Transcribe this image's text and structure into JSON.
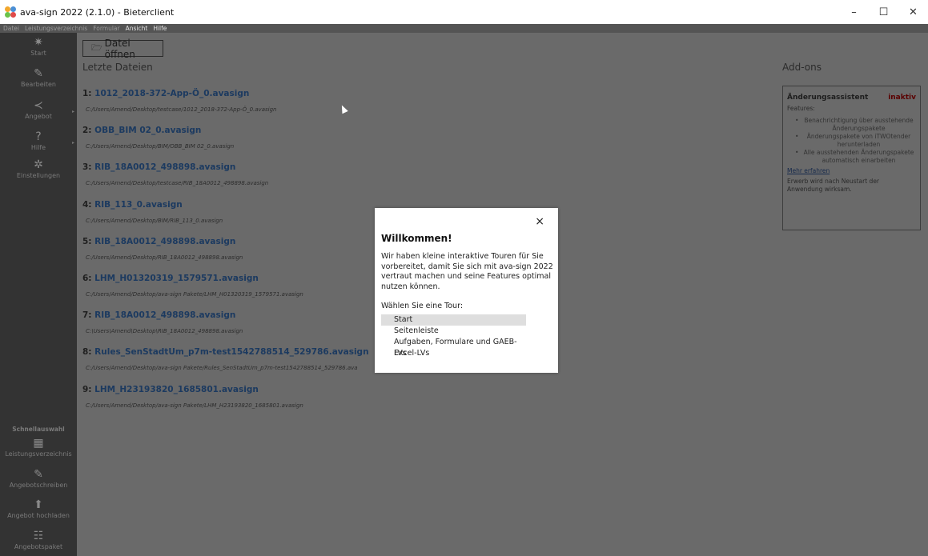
{
  "window": {
    "title": "ava-sign 2022 (2.1.0) - Bieterclient",
    "controls": {
      "minimize": "–",
      "maximize": "☐",
      "close": "✕"
    }
  },
  "menu": [
    "Datei",
    "Leistungsverzeichnis",
    "Formular",
    "Ansicht",
    "Hilfe"
  ],
  "sidebar": {
    "items": [
      {
        "icon": "✷",
        "label": "Start"
      },
      {
        "icon": "✎",
        "label": "Bearbeiten"
      },
      {
        "icon": "≺",
        "label": "Angebot"
      },
      {
        "icon": "?",
        "label": "Hilfe"
      },
      {
        "icon": "✲",
        "label": "Einstellungen"
      }
    ],
    "quick_title": "Schnellauswahl",
    "quick_items": [
      {
        "icon": "▦",
        "label": "Leistungsverzeichnis"
      },
      {
        "icon": "✎",
        "label": "Angebotschreiben"
      },
      {
        "icon": "⬆",
        "label": "Angebot hochladen"
      },
      {
        "icon": "☷",
        "label": "Angebotspaket"
      }
    ]
  },
  "main": {
    "open_button": {
      "icon": "🗁",
      "label": "Datei öffnen"
    },
    "recent_title": "Letzte Dateien",
    "recent_files": [
      {
        "index": "1:",
        "name": "1012_2018-372-App-Ö_0.avasign",
        "path": "C:/Users/Amend/Desktop/testcase/1012_2018-372-App-Ö_0.avasign"
      },
      {
        "index": "2:",
        "name": "OBB_BIM 02_0.avasign",
        "path": "C:/Users/Amend/Desktop/BIM/OBB_BIM 02_0.avasign"
      },
      {
        "index": "3:",
        "name": "RIB_18A0012_498898.avasign",
        "path": "C:/Users/Amend/Desktop/testcase/RIB_18A0012_498898.avasign"
      },
      {
        "index": "4:",
        "name": "RIB_113_0.avasign",
        "path": "C:/Users/Amend/Desktop/BIM/RIB_113_0.avasign"
      },
      {
        "index": "5:",
        "name": "RIB_18A0012_498898.avasign",
        "path": "C:/Users/Amend/Desktop/RIB_18A0012_498898.avasign"
      },
      {
        "index": "6:",
        "name": "LHM_H01320319_1579571.avasign",
        "path": "C:/Users/Amend/Desktop/ava-sign Pakete/LHM_H01320319_1579571.avasign"
      },
      {
        "index": "7:",
        "name": "RIB_18A0012_498898.avasign",
        "path": "C:\\Users\\Amend\\Desktop\\RIB_18A0012_498898.avasign"
      },
      {
        "index": "8:",
        "name": "Rules_SenStadtUm_p7m-test1542788514_529786.avasign",
        "path": "C:/Users/Amend/Desktop/ava-sign Pakete/Rules_SenStadtUm_p7m-test1542788514_529786.ava"
      },
      {
        "index": "9:",
        "name": "LHM_H23193820_1685801.avasign",
        "path": "C:/Users/Amend/Desktop/ava-sign Pakete/LHM_H23193820_1685801.avasign"
      }
    ],
    "addons_title": "Add-ons",
    "addon": {
      "name": "Änderungsassistent",
      "status": "inaktiv",
      "features_label": "Features:",
      "features": [
        "Benachrichtigung über ausstehende Änderungspakete",
        "Änderungspakete von iTWOtender herunterladen",
        "Alle ausstehenden Änderungspakete automatisch einarbeiten"
      ],
      "link": "Mehr erfahren",
      "note": "Erwerb wird nach Neustart der Anwendung wirksam."
    }
  },
  "dialog": {
    "close": "×",
    "title": "Willkommen!",
    "text": "Wir haben kleine interaktive Touren für Sie vorbereitet, damit Sie sich mit ava-sign 2022 vertraut machen und seine Features optimal nutzen können.",
    "choose": "Wählen Sie eine Tour:",
    "tours": [
      "Start",
      "Seitenleiste",
      "Aufgaben, Formulare und GAEB-LVs",
      "Excel-LVs"
    ]
  }
}
